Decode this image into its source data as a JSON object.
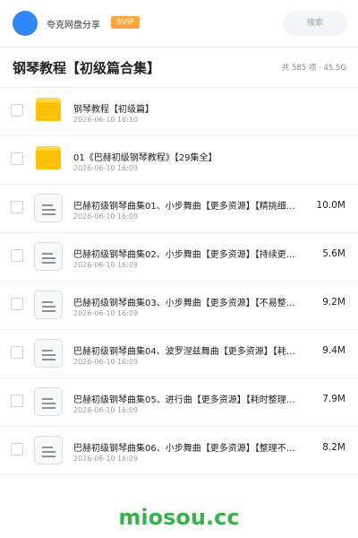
{
  "header": {
    "brand": "夸克网盘分享",
    "badge": "SVIP",
    "search_placeholder": "搜索",
    "accent_color": "#2f86f6",
    "badge_color": "#ffa53d"
  },
  "title_bar": {
    "title": "钢琴教程【初级篇合集】",
    "summary": "共 585 项 · 45.5G"
  },
  "files": [
    {
      "type": "folder",
      "icon": "folder-icon",
      "name": "钢琴教程【初级篇】",
      "date": "2026-06-10 16:10",
      "size": ""
    },
    {
      "type": "folder",
      "icon": "folder-icon",
      "name": "01《巴赫初级钢琴教程》【29集全】",
      "date": "2026-06-10 16:09",
      "size": ""
    },
    {
      "type": "doc",
      "icon": "document-icon",
      "name": "巴赫初级钢琴曲集01、小步舞曲【更多资源】【精挑细…",
      "date": "2026-06-10 16:09",
      "size": "10.0M"
    },
    {
      "type": "doc",
      "icon": "document-icon",
      "name": "巴赫初级钢琴曲集02、小步舞曲【更多资源】【持续更…",
      "date": "2026-06-10 16:09",
      "size": "5.6M"
    },
    {
      "type": "doc",
      "icon": "document-icon",
      "name": "巴赫初级钢琴曲集03、小步舞曲【更多资源】【不易整…",
      "date": "2026-06-10 16:09",
      "size": "9.2M"
    },
    {
      "type": "doc",
      "icon": "document-icon",
      "name": "巴赫初级钢琴曲集04、波罗涅兹舞曲【更多资源】【耗…",
      "date": "2026-06-10 16:09",
      "size": "9.4M"
    },
    {
      "type": "doc",
      "icon": "document-icon",
      "name": "巴赫初级钢琴曲集05、进行曲【更多资源】【耗时整理…",
      "date": "2026-06-10 16:09",
      "size": "7.9M"
    },
    {
      "type": "doc",
      "icon": "document-icon",
      "name": "巴赫初级钢琴曲集06、小步舞曲【更多资源】【整理不…",
      "date": "2026-06-10 16:09",
      "size": "8.2M"
    }
  ],
  "watermark": "miosou.cc"
}
